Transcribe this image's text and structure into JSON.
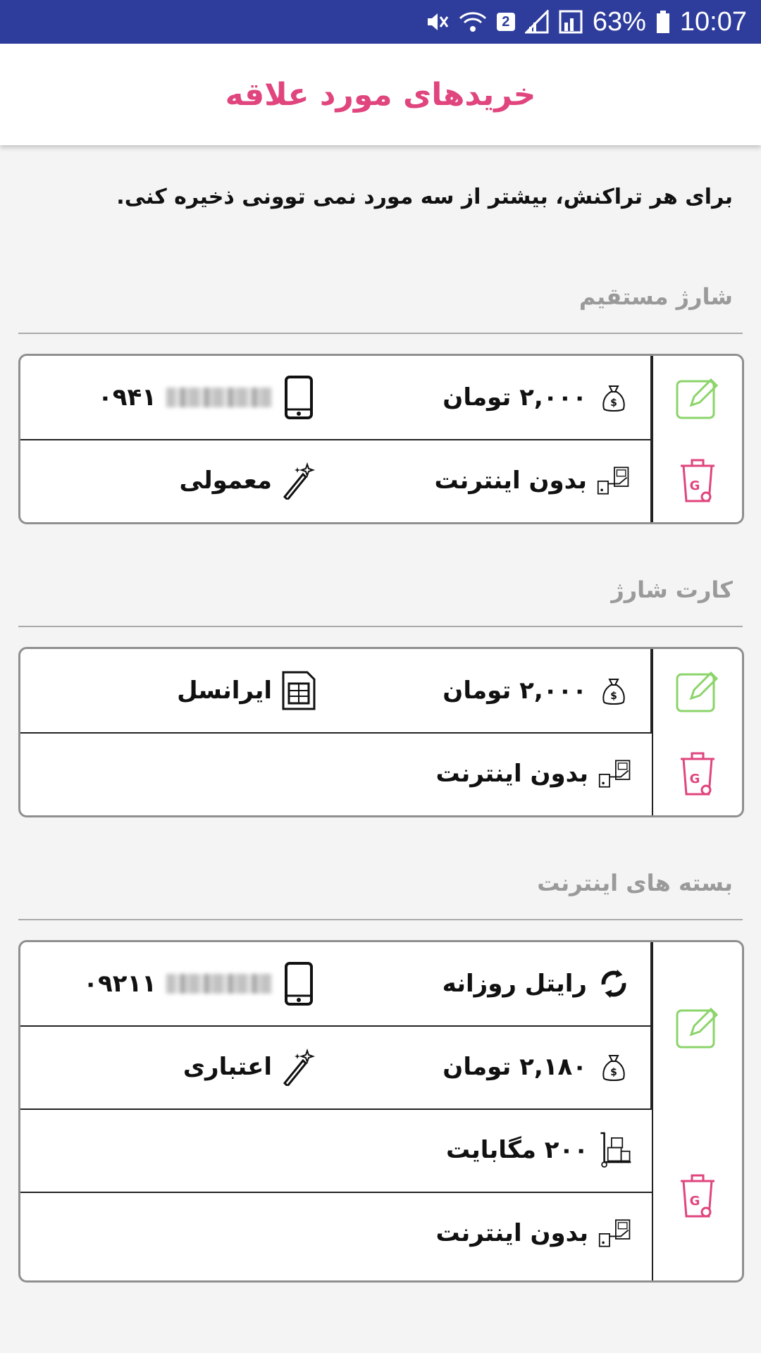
{
  "status_bar": {
    "sim_badge": "2",
    "battery_percent": "63%",
    "time": "10:07"
  },
  "app_bar": {
    "title": "خریدهای مورد علاقه"
  },
  "info_text": "برای هر تراکنش، بیشتر از سه مورد نمی توونی ذخیره کنی.",
  "sections": [
    {
      "title": "شارژ مستقیم",
      "card": {
        "phone": "۰۹۴۱",
        "amount": "۲,۰۰۰ تومان",
        "type": "معمولی",
        "payment": "بدون اینترنت"
      }
    },
    {
      "title": "کارت شارژ",
      "card": {
        "operator": "ایرانسل",
        "amount": "۲,۰۰۰ تومان",
        "payment": "بدون اینترنت"
      }
    },
    {
      "title": "بسته های اینترنت",
      "card": {
        "phone": "۰۹۲۱۱",
        "package": "رایتل روزانه",
        "type": "اعتباری",
        "amount": "۲,۱۸۰ تومان",
        "volume": "۲۰۰ مگابایت",
        "payment": "بدون اینترنت"
      }
    }
  ],
  "colors": {
    "status_bar": "#2e3d9c",
    "title": "#e0457e",
    "edit_icon": "#8bd46a",
    "delete_icon": "#e0457e"
  }
}
